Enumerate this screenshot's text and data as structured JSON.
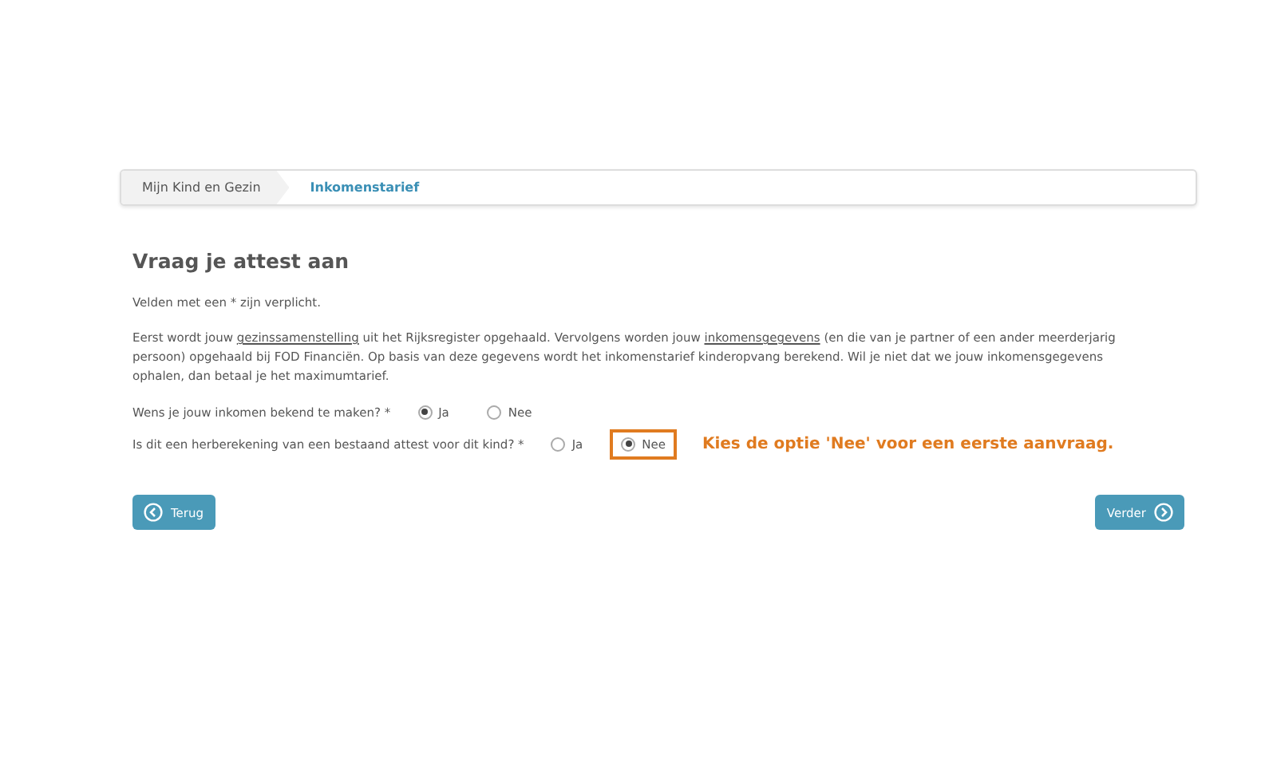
{
  "breadcrumb": [
    {
      "label": "Mijn Kind en Gezin",
      "selected": false
    },
    {
      "label": "Inkomenstarief",
      "selected": true
    }
  ],
  "title": "Vraag je attest aan",
  "required_note": "Velden met een * zijn verplicht.",
  "intro": [
    {
      "kind": "text",
      "text": "Eerst wordt jouw"
    },
    {
      "kind": "link",
      "text": "gezinssamenstelling"
    },
    {
      "kind": "text",
      "text": "uit het Rijksregister opgehaald. Vervolgens worden jouw"
    },
    {
      "kind": "link",
      "text": "inkomensgegevens"
    },
    {
      "kind": "text",
      "text": "(en die van je partner of een ander meerderjarig persoon) opgehaald bij FOD Financiën. Op basis van deze gegevens wordt het inkomenstarief kinderopvang berekend. Wil je niet dat we jouw inkomensgegevens ophalen, dan betaal je het maximumtarief."
    }
  ],
  "questions": [
    {
      "label": "Wens je jouw inkomen bekend te maken? *",
      "options": [
        {
          "label": "Ja",
          "selected": true,
          "highlighted": false
        },
        {
          "label": "Nee",
          "selected": false,
          "highlighted": false
        }
      ]
    },
    {
      "label": "Is dit een herberekening van een bestaand attest voor dit kind? *",
      "options": [
        {
          "label": "Ja",
          "selected": false,
          "highlighted": false
        },
        {
          "label": "Nee",
          "selected": true,
          "highlighted": true
        }
      ],
      "callout": "Kies de optie 'Nee' voor een eerste aanvraag."
    }
  ],
  "buttons": [
    {
      "label": "Terug",
      "kind": "back"
    },
    {
      "label": "Verder",
      "kind": "next"
    }
  ]
}
